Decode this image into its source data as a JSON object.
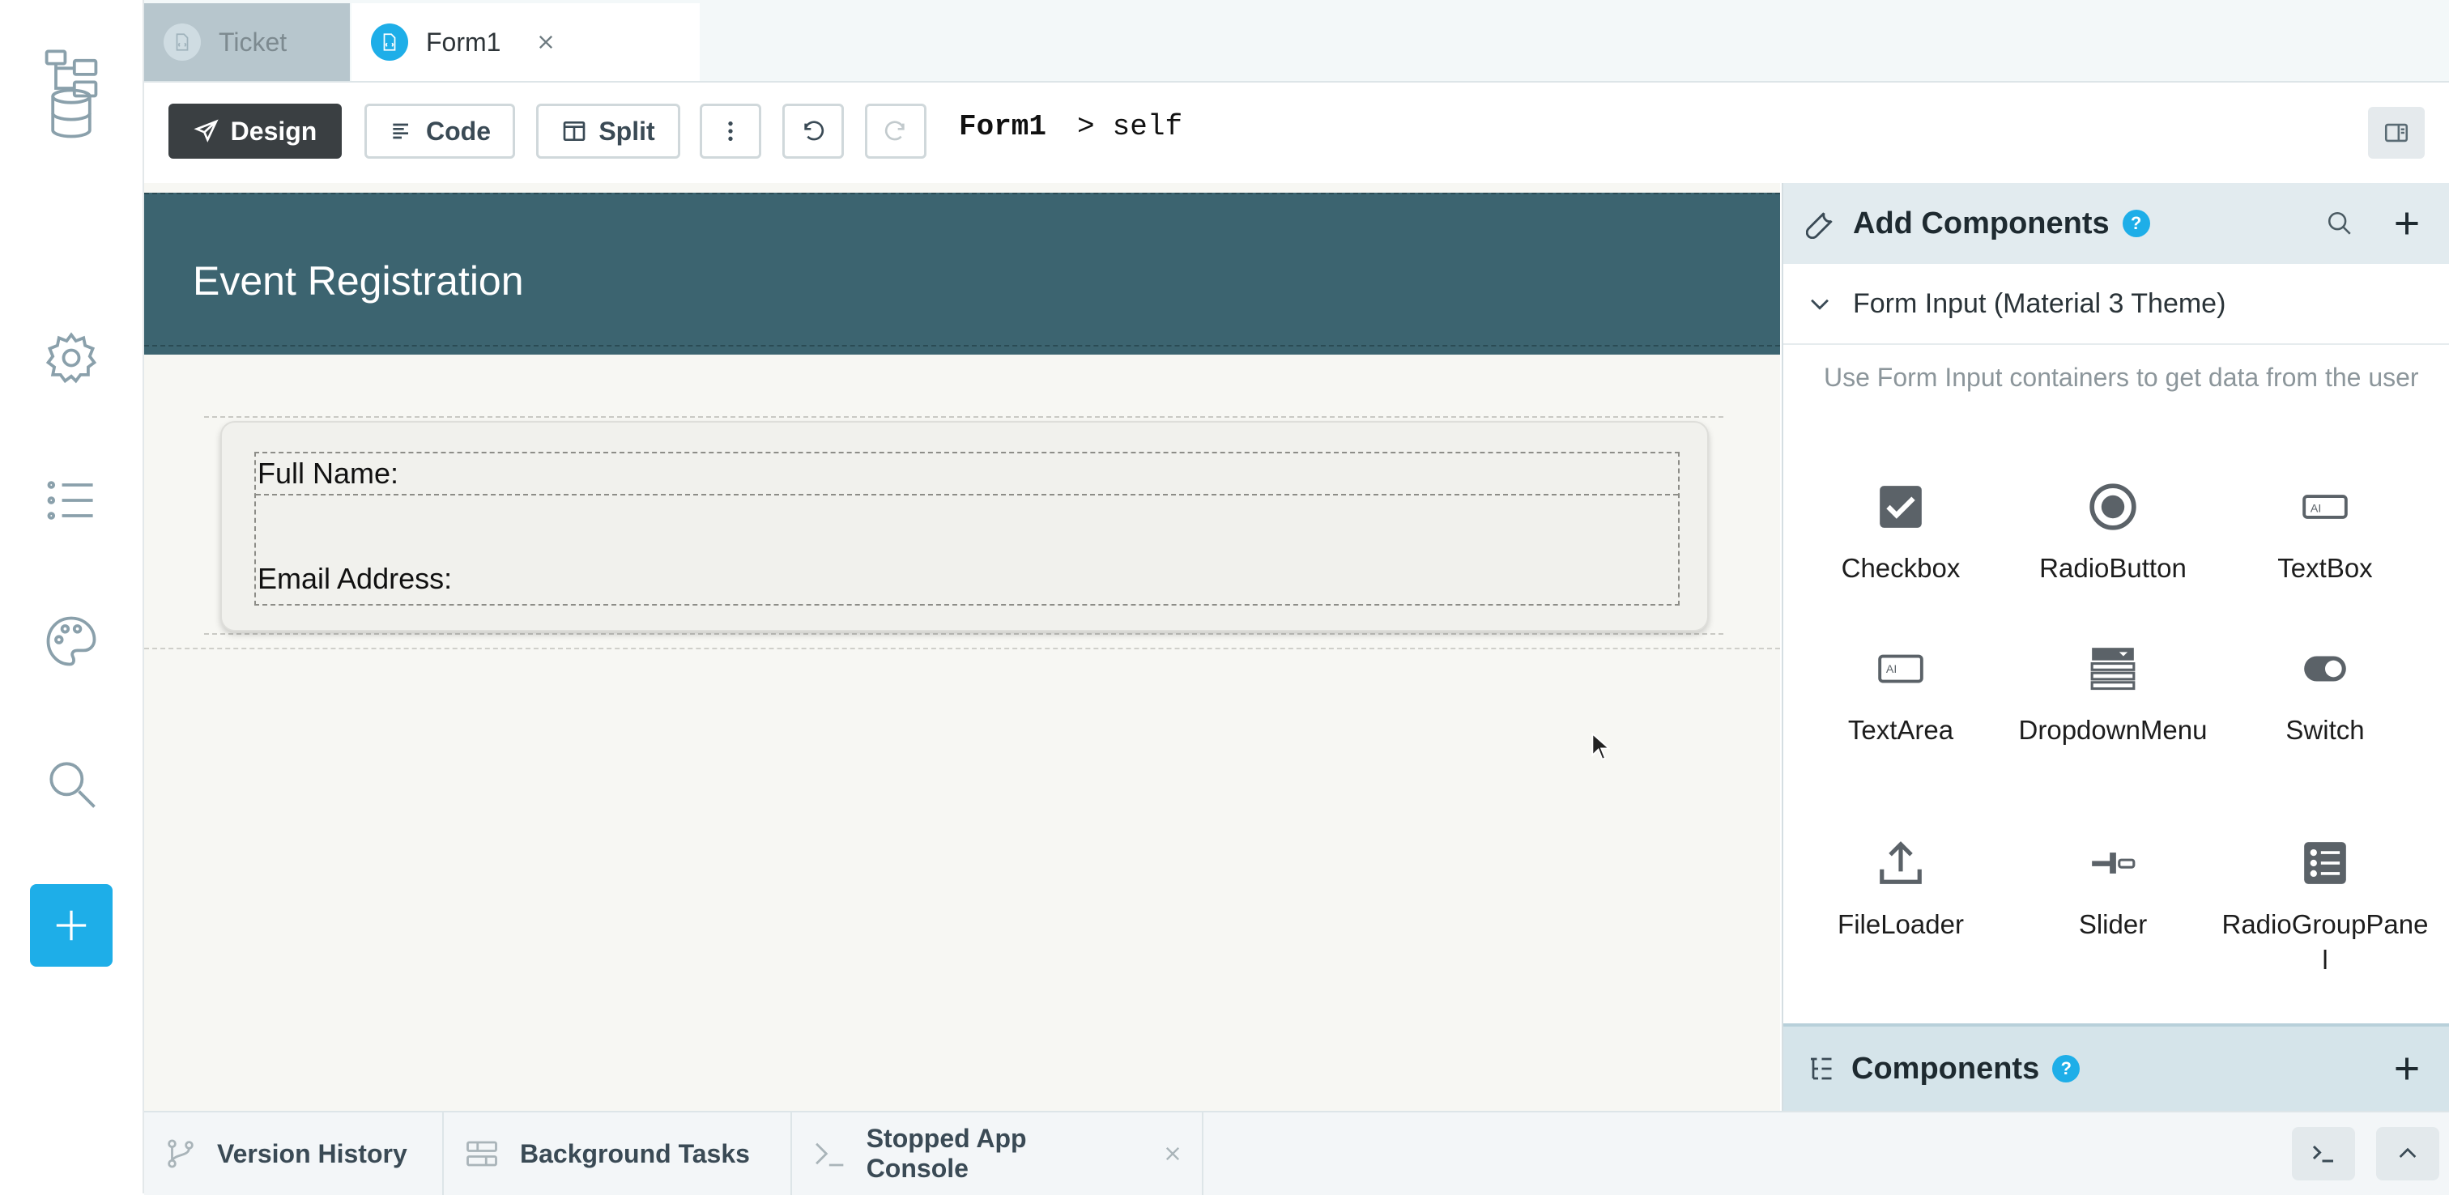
{
  "colors": {
    "accent": "#1eaee8",
    "header_band": "#3c6470",
    "design_button": "#3a3f42",
    "canvas": "#f7f7f3",
    "panel_header": "#e2ebef"
  },
  "rail": {
    "items": [
      {
        "icon": "app-tree-icon"
      },
      {
        "icon": "database-icon"
      },
      {
        "icon": "gear-icon"
      },
      {
        "icon": "list-icon"
      },
      {
        "icon": "palette-icon"
      },
      {
        "icon": "search-icon"
      }
    ],
    "add_icon": "plus-icon"
  },
  "tabs": [
    {
      "label": "Ticket",
      "active": false
    },
    {
      "label": "Form1",
      "active": true,
      "closable": true
    }
  ],
  "toolbar": {
    "design_label": "Design",
    "code_label": "Code",
    "split_label": "Split",
    "breadcrumb": {
      "form": "Form1",
      "separator": ">",
      "target": "self"
    }
  },
  "canvas": {
    "form_title": "Event Registration",
    "fields": [
      {
        "label": "Full Name:"
      },
      {
        "label": "Email Address:"
      }
    ]
  },
  "add_components": {
    "title": "Add Components",
    "help": "?",
    "section": {
      "title": "Form Input (Material 3 Theme)",
      "expanded": true,
      "description": "Use Form Input containers to get data from the user"
    },
    "items": [
      {
        "label": "Checkbox",
        "icon": "checkbox-icon"
      },
      {
        "label": "RadioButton",
        "icon": "radio-button-icon"
      },
      {
        "label": "TextBox",
        "icon": "textbox-icon"
      },
      {
        "label": "TextArea",
        "icon": "textarea-icon"
      },
      {
        "label": "DropdownMenu",
        "icon": "dropdown-menu-icon"
      },
      {
        "label": "Switch",
        "icon": "switch-icon"
      },
      {
        "label": "FileLoader",
        "icon": "upload-icon"
      },
      {
        "label": "Slider",
        "icon": "slider-icon"
      },
      {
        "label": "RadioGroupPanel",
        "icon": "radio-group-icon"
      }
    ]
  },
  "components_panel": {
    "title": "Components",
    "help": "?"
  },
  "bottom_tabs": [
    {
      "label": "Version History",
      "icon": "branch-icon"
    },
    {
      "label": "Background Tasks",
      "icon": "tasks-icon"
    },
    {
      "label": "Stopped App Console",
      "icon": "terminal-icon",
      "closable": true
    }
  ]
}
